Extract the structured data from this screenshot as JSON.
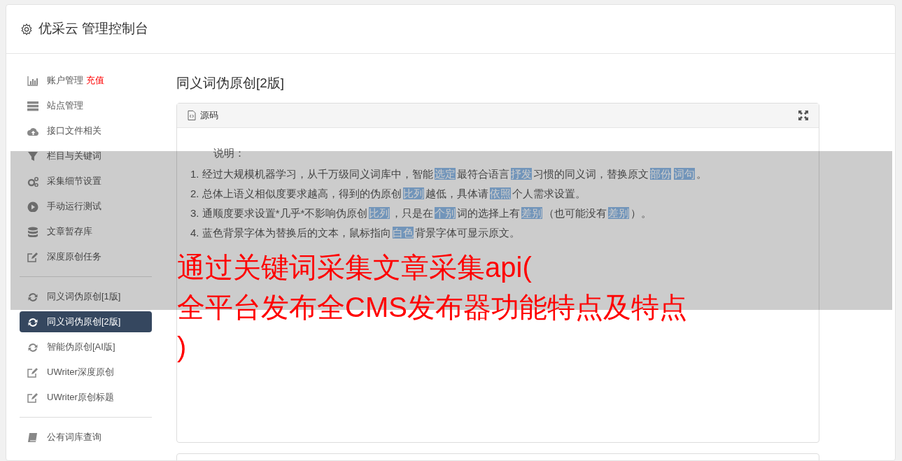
{
  "header": {
    "title": "优采云 管理控制台"
  },
  "sidebar": {
    "groups": [
      {
        "items": [
          {
            "label": "账户管理",
            "badge": "充值",
            "selected": false
          },
          {
            "label": "站点管理",
            "selected": false
          },
          {
            "label": "接口文件相关",
            "selected": false
          },
          {
            "label": "栏目与关键词",
            "selected": false
          },
          {
            "label": "采集细节设置",
            "selected": false
          },
          {
            "label": "手动运行测试",
            "selected": false
          },
          {
            "label": "文章暂存库",
            "selected": false
          },
          {
            "label": "深度原创任务",
            "selected": false
          }
        ]
      },
      {
        "items": [
          {
            "label": "同义词伪原创[1版]",
            "selected": false
          },
          {
            "label": "同义词伪原创[2版]",
            "selected": true
          },
          {
            "label": "智能伪原创[AI版]",
            "selected": false
          },
          {
            "label": "UWriter深度原创",
            "selected": false
          },
          {
            "label": "UWriter原创标题",
            "selected": false
          }
        ]
      },
      {
        "items": [
          {
            "label": "公有词库查询",
            "selected": false
          }
        ]
      }
    ]
  },
  "content": {
    "title": "同义词伪原创[2版]",
    "panel": {
      "title": "源码",
      "heading": "说明：",
      "lines": [
        [
          {
            "text": "1. 经过大规模机器学习，从千万级同义词库中，智能",
            "replaced": false
          },
          {
            "text": "选定",
            "replaced": true
          },
          {
            "text": "最符合语言",
            "replaced": false
          },
          {
            "text": "抒发",
            "replaced": true
          },
          {
            "text": "习惯的同义词，替换原文",
            "replaced": false
          },
          {
            "text": "部份",
            "replaced": true
          },
          {
            "text": "词句",
            "replaced": true
          },
          {
            "text": "。",
            "replaced": false
          }
        ],
        [
          {
            "text": "2. 总体上语义相似度要求越高，得到的伪原创",
            "replaced": false
          },
          {
            "text": "比列",
            "replaced": true
          },
          {
            "text": "越低，具体请",
            "replaced": false
          },
          {
            "text": "依照",
            "replaced": true
          },
          {
            "text": "个人需求设置。",
            "replaced": false
          }
        ],
        [
          {
            "text": "3. 通顺度要求设置*几乎*不影响伪原创",
            "replaced": false
          },
          {
            "text": "比列",
            "replaced": true
          },
          {
            "text": "，只是在",
            "replaced": false
          },
          {
            "text": "个别",
            "replaced": true
          },
          {
            "text": "词的选择上有",
            "replaced": false
          },
          {
            "text": "差别",
            "replaced": true
          },
          {
            "text": "（也可能没有",
            "replaced": false
          },
          {
            "text": "差别",
            "replaced": true
          },
          {
            "text": "）。",
            "replaced": false
          }
        ],
        [
          {
            "text": "4. 蓝色背景字体为替换后的文本，鼠标指向",
            "replaced": false
          },
          {
            "text": "白色",
            "replaced": true
          },
          {
            "text": "背景字体可显示原文。",
            "replaced": false
          }
        ]
      ]
    }
  },
  "overlay": {
    "title_lines": [
      "通过关键词采集文章采集api(",
      "全平台发布全CMS发布器功能特点及特点",
      ")"
    ]
  }
}
